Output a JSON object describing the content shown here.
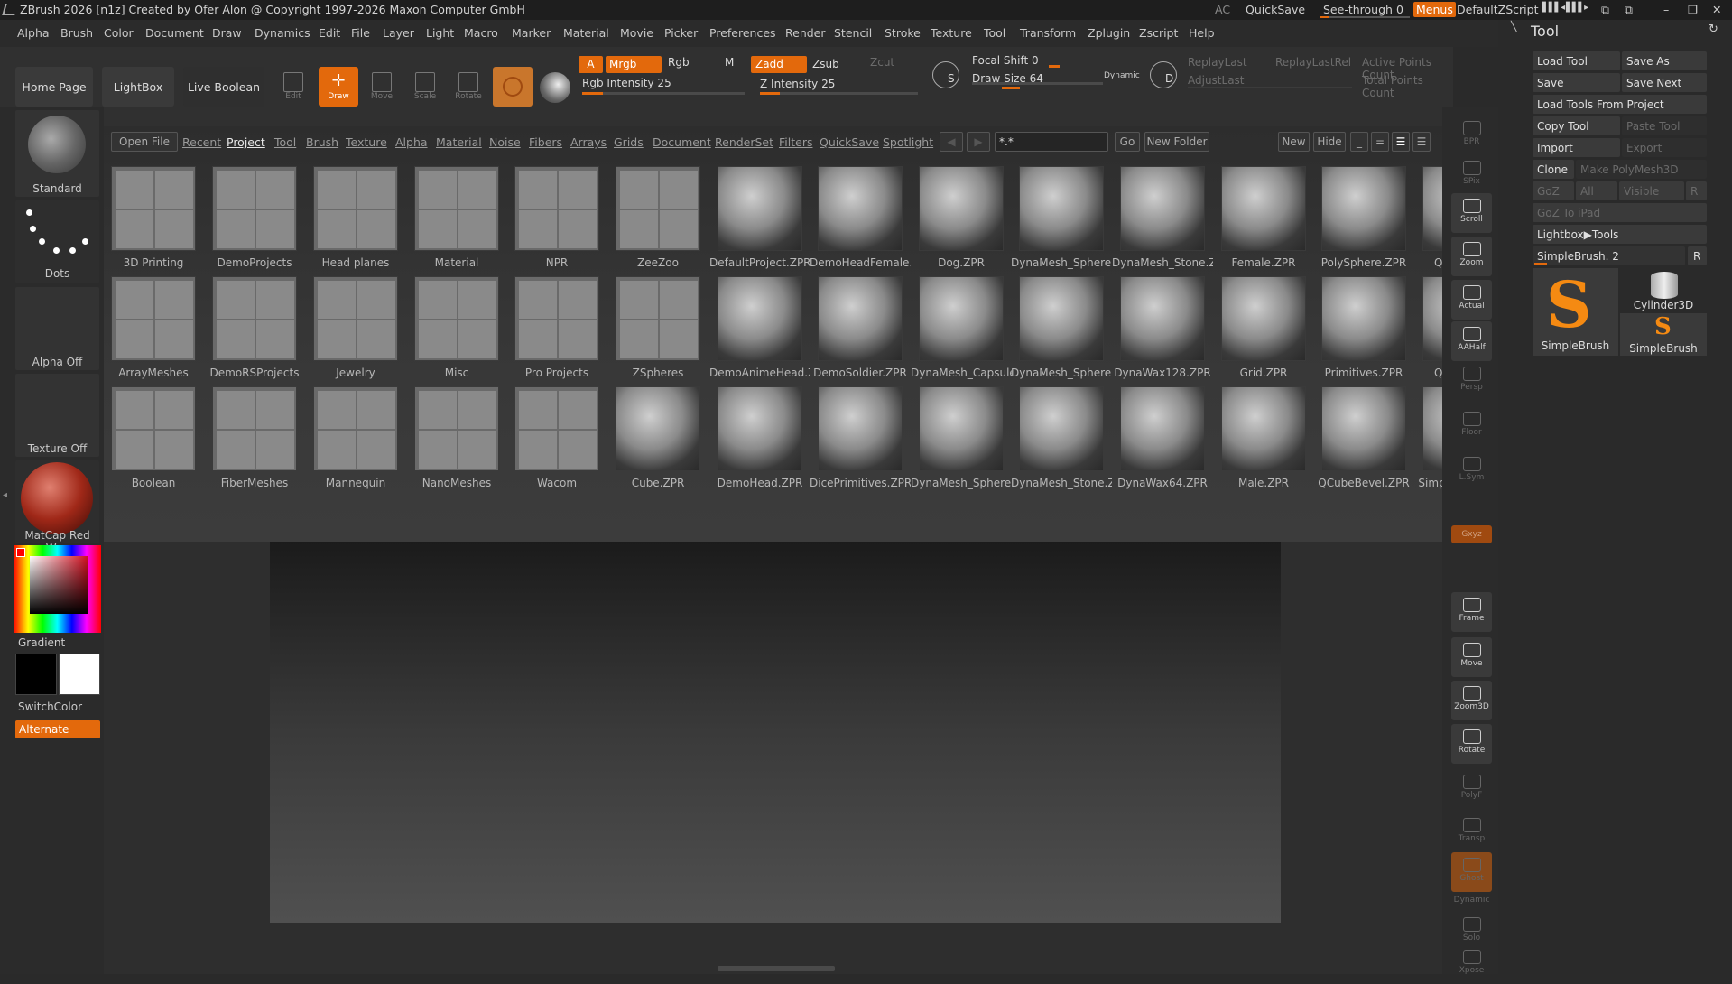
{
  "window": {
    "title": "ZBrush 2026 [n1z] Created by Ofer Alon @ Copyright 1997-2026 Maxon Computer GmbH"
  },
  "topright": {
    "ac": "AC",
    "quicksave": "QuickSave",
    "seethrough": "See-through",
    "seethrough_value": "0",
    "menus": "Menus",
    "script": "DefaultZScript"
  },
  "menus": [
    "Alpha",
    "Brush",
    "Color",
    "Document",
    "Draw",
    "Dynamics",
    "Edit",
    "File",
    "Layer",
    "Light",
    "Macro",
    "Marker",
    "Material",
    "Movie",
    "Picker",
    "Preferences",
    "Render",
    "Stencil",
    "Stroke",
    "Texture",
    "Tool",
    "Transform",
    "Zplugin",
    "Zscript",
    "Help"
  ],
  "shelf": {
    "home": "Home Page",
    "lightbox": "LightBox",
    "liveboolean": "Live Boolean",
    "tools": [
      "Edit",
      "Draw",
      "Move",
      "Scale",
      "Rotate"
    ],
    "a": "A",
    "mrgb": "Mrgb",
    "rgb": "Rgb",
    "m": "M",
    "rgb_intensity": "Rgb Intensity 25",
    "rgb_intensity_value": 0.25,
    "zadd": "Zadd",
    "zsub": "Zsub",
    "zcut": "Zcut",
    "z_intensity": "Z Intensity 25",
    "z_intensity_value": 0.25,
    "focal_shift": "Focal Shift 0",
    "draw_size": "Draw Size 64",
    "dynamic": "Dynamic",
    "s_label": "S",
    "d_label": "D",
    "replay_last": "ReplayLast",
    "replay_last_rel": "ReplayLastRel",
    "adjust_last": "AdjustLast",
    "active_points": "Active Points Count",
    "total_points": "Total Points Count"
  },
  "left": {
    "standard": "Standard",
    "dots": "Dots",
    "alpha_off": "Alpha Off",
    "texture_off": "Texture Off",
    "matcap": "MatCap Red Wax",
    "gradient": "Gradient",
    "switchcolor": "SwitchColor",
    "alternate": "Alternate"
  },
  "lightbox": {
    "tabs": [
      "Open File",
      "Recent",
      "Project",
      "Tool",
      "Brush",
      "Texture",
      "Alpha",
      "Material",
      "Noise",
      "Fibers",
      "Arrays",
      "Grids",
      "Document",
      "RenderSet",
      "Filters",
      "QuickSave",
      "Spotlight"
    ],
    "active_tab": "Project",
    "search_value": "*.*",
    "go": "Go",
    "new_folder": "New Folder",
    "new": "New",
    "hide": "Hide",
    "rows": [
      [
        "3D Printing",
        "DemoProjects",
        "Head planes",
        "Material",
        "NPR",
        "ZeeZoo",
        "DefaultProject.ZPR",
        "DemoHeadFemale.ZPR",
        "Dog.ZPR",
        "DynaMesh_Sphere.ZPR",
        "DynaMesh_Stone.ZPR",
        "Female.ZPR",
        "PolySphere.ZPR",
        "QCube.ZPR"
      ],
      [
        "ArrayMeshes",
        "DemoRSProjects",
        "Jewelry",
        "Misc",
        "Pro Projects",
        "ZSpheres",
        "DemoAnimeHead.ZPR",
        "DemoSoldier.ZPR",
        "DynaMesh_Capsule.ZPR",
        "DynaMesh_Sphere.ZPR",
        "DynaWax128.ZPR",
        "Grid.ZPR",
        "Primitives.ZPR",
        "QCube.ZPR"
      ],
      [
        "Boolean",
        "FiberMeshes",
        "Mannequin",
        "NanoMeshes",
        "Wacom",
        "Cube.ZPR",
        "DemoHead.ZPR",
        "DicePrimitives.ZPR",
        "DynaMesh_Sphere.ZPR",
        "DynaMesh_Stone.ZPR",
        "DynaWax64.ZPR",
        "Male.ZPR",
        "QCubeBevel.ZPR",
        "SimpleBrush.ZPR"
      ]
    ]
  },
  "rightstrip": [
    "BPR",
    "SPix",
    "Scroll",
    "Zoom",
    "Actual",
    "AAHalf",
    "Persp",
    "Floor",
    "L.Sym",
    "",
    "Gxyz",
    "",
    "",
    "Frame",
    "Move",
    "Zoom3D",
    "Rotate",
    "PolyF",
    "Transp",
    "Ghost",
    "Dynamic",
    "Solo",
    "Xpose"
  ],
  "toolpanel": {
    "title": "Tool",
    "load_tool": "Load Tool",
    "save_as": "Save As",
    "save": "Save",
    "save_next": "Save Next",
    "load_from_project": "Load Tools From Project",
    "copy_tool": "Copy Tool",
    "paste_tool": "Paste Tool",
    "import": "Import",
    "export": "Export",
    "clone": "Clone",
    "make_polymesh": "Make PolyMesh3D",
    "goz": "GoZ",
    "all": "All",
    "visible": "Visible",
    "r": "R",
    "goz_ipad": "GoZ To iPad",
    "lightbox_tools": "Lightbox▶Tools",
    "current_tool": "SimpleBrush. 2",
    "thumbs": [
      "SimpleBrush",
      "Cylinder3D",
      "SimpleBrush"
    ]
  },
  "colors": {
    "accent": "#e3690c",
    "bg": "#2a2a2a"
  }
}
